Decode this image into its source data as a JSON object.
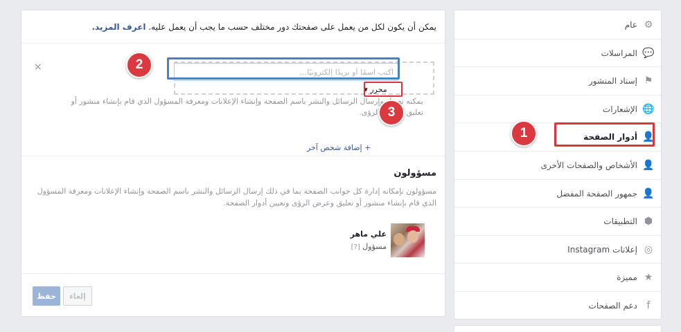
{
  "sidebar": {
    "items": [
      {
        "label": "عام",
        "icon": "gear-icon",
        "glyph": "⚙"
      },
      {
        "label": "المراسلات",
        "icon": "messages-icon",
        "glyph": "💬"
      },
      {
        "label": "إسناد المنشور",
        "icon": "flag-icon",
        "glyph": "⚑"
      },
      {
        "label": "الإشعارات",
        "icon": "globe-icon",
        "glyph": "🌐"
      },
      {
        "label": "أدوار الصفحة",
        "icon": "person-icon",
        "glyph": "👤"
      },
      {
        "label": "الأشخاص والصفحات الأخرى",
        "icon": "person-star-icon",
        "glyph": "👤"
      },
      {
        "label": "جمهور الصفحة المفضل",
        "icon": "person-star-icon",
        "glyph": "👤"
      },
      {
        "label": "التطبيقات",
        "icon": "cube-icon",
        "glyph": "⬢"
      },
      {
        "label": "إعلانات Instagram",
        "icon": "instagram-icon",
        "glyph": "◎"
      },
      {
        "label": "مميزة",
        "icon": "star-icon",
        "glyph": "★"
      },
      {
        "label": "دعم الصفحات",
        "icon": "facebook-icon",
        "glyph": "f"
      }
    ]
  },
  "main": {
    "intro_text": "يمكن أن يكون لكل من يعمل على صفحتك دور مختلف حسب ما يجب أن يعمل عليه.",
    "intro_link": "اعرف المزيد.",
    "assign": {
      "close_label": "×",
      "search_placeholder": "اكتب اسمًا أو بريدًا إلكترونيًا...",
      "role_value": "محرر ▾",
      "role_description": "يمكنه تعديل وإرسال الرسائل والنشر باسم الصفحة وإنشاء الإعلانات ومعرفة المسؤول الذي قام بإنشاء منشور أو تعليق وعرض الرؤى.",
      "add_person": "+ إضافة شخص آخر"
    },
    "admins": {
      "heading": "مسؤولون",
      "description": "مسؤولون بإمكانه إدارة كل جوانب الصفحة بما في ذلك إرسال الرسائل والنشر باسم الصفحة وإنشاء الإعلانات ومعرفة المسؤول الذي قام بإنشاء منشور أو تعليق وعرض الرؤى وتعيين أدوار الصفحة.",
      "user": {
        "name": "علي ماهر",
        "role": "مسؤول",
        "help": "[?]"
      }
    },
    "buttons": {
      "save": "حفظ",
      "cancel": "إلغاء"
    }
  },
  "annotations": {
    "m1": "1",
    "m2": "2",
    "m3": "3"
  },
  "colors": {
    "link": "#365899",
    "marker": "#d9393f",
    "highlight_red": "#e0343c",
    "highlight_blue": "#4a7fc1"
  }
}
